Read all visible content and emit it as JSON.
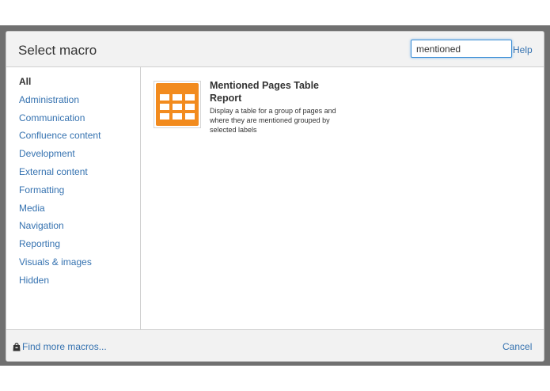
{
  "dialog": {
    "title": "Select macro",
    "search": {
      "value": "mentioned",
      "placeholder": ""
    },
    "help_label": "Help"
  },
  "sidebar": {
    "items": [
      {
        "label": "All",
        "active": true
      },
      {
        "label": "Administration"
      },
      {
        "label": "Communication"
      },
      {
        "label": "Confluence content"
      },
      {
        "label": "Development"
      },
      {
        "label": "External content"
      },
      {
        "label": "Formatting"
      },
      {
        "label": "Media"
      },
      {
        "label": "Navigation"
      },
      {
        "label": "Reporting"
      },
      {
        "label": "Visuals & images"
      },
      {
        "label": "Hidden"
      }
    ]
  },
  "results": [
    {
      "icon": "table-icon",
      "name": "Mentioned Pages Table Report",
      "description": "Display a table for a group of pages and where they are mentioned grouped by selected labels"
    }
  ],
  "footer": {
    "find_more_icon": "marketplace-bag-icon",
    "find_more_label": "Find more macros...",
    "cancel_label": "Cancel"
  },
  "colors": {
    "link": "#3572b0",
    "icon_orange": "#f28b1e",
    "overlay": "#707070",
    "focus_border": "#3d8fd6"
  }
}
